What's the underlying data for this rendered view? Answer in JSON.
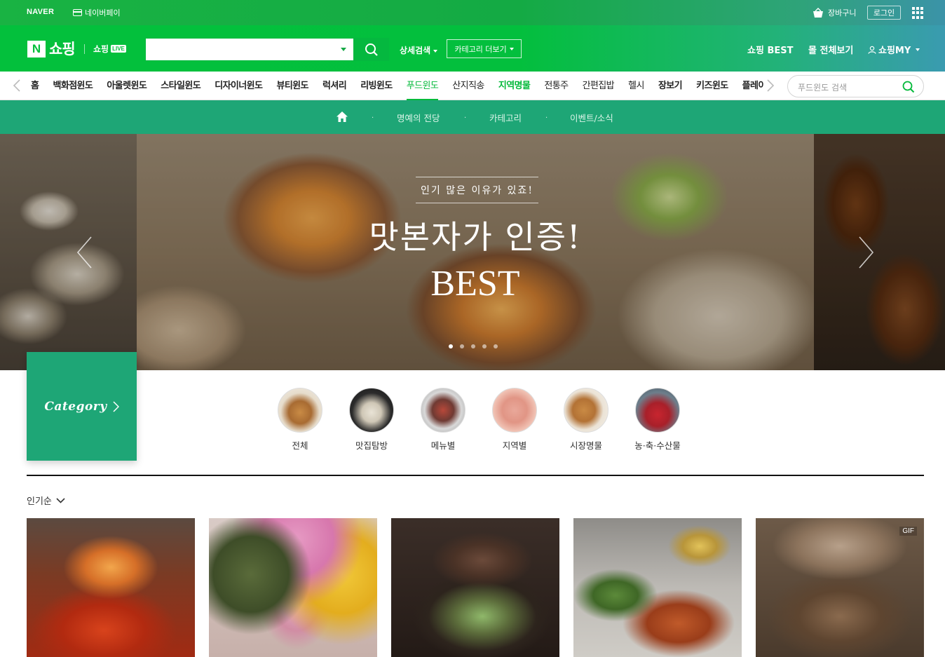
{
  "top_bar": {
    "naver": "NAVER",
    "naverpay": "네이버페이",
    "cart": "장바구니",
    "login": "로그인"
  },
  "header": {
    "logo_n": "N",
    "shop": "쇼핑",
    "shop_live": "쇼핑",
    "live_badge": "LIVE",
    "search_value": "",
    "detail_search": "상세검색",
    "category_more": "카테고리 더보기",
    "shop_best": "쇼핑 BEST",
    "mall_all": "몰 전체보기",
    "shop_my": "쇼핑MY"
  },
  "nav": {
    "items": [
      {
        "label": "홈"
      },
      {
        "label": "백화점윈도"
      },
      {
        "label": "아울렛윈도"
      },
      {
        "label": "스타일윈도"
      },
      {
        "label": "디자이너윈도"
      },
      {
        "label": "뷰티윈도"
      },
      {
        "label": "럭셔리"
      },
      {
        "label": "리빙윈도"
      },
      {
        "label": "푸드윈도"
      },
      {
        "label": "산지직송"
      },
      {
        "label": "지역명물"
      },
      {
        "label": "전통주"
      },
      {
        "label": "간편집밥"
      },
      {
        "label": "헬시"
      },
      {
        "label": "장보기"
      },
      {
        "label": "키즈윈도"
      },
      {
        "label": "플레이윈도"
      }
    ],
    "search_placeholder": "푸드윈도 검색"
  },
  "sub_nav": {
    "items": [
      "명예의 전당",
      "카테고리",
      "이벤트/소식"
    ]
  },
  "banner": {
    "subtitle": "인기 많은 이유가 있죠!",
    "title": "맛본자가 인증!",
    "title2": "BEST",
    "dots_total": 5,
    "dots_active": 1
  },
  "category_tile": {
    "label": "Category"
  },
  "categories": [
    {
      "label": "전체"
    },
    {
      "label": "맛집탐방"
    },
    {
      "label": "메뉴별"
    },
    {
      "label": "지역별"
    },
    {
      "label": "시장명물"
    },
    {
      "label": "농·축·수산물"
    }
  ],
  "sort": {
    "label": "인기순"
  },
  "products": [
    {
      "badge": ""
    },
    {
      "badge": ""
    },
    {
      "badge": ""
    },
    {
      "badge": ""
    },
    {
      "badge": "GIF"
    }
  ],
  "colors": {
    "naver_green": "#03c03c",
    "food_teal": "#1ea676"
  }
}
